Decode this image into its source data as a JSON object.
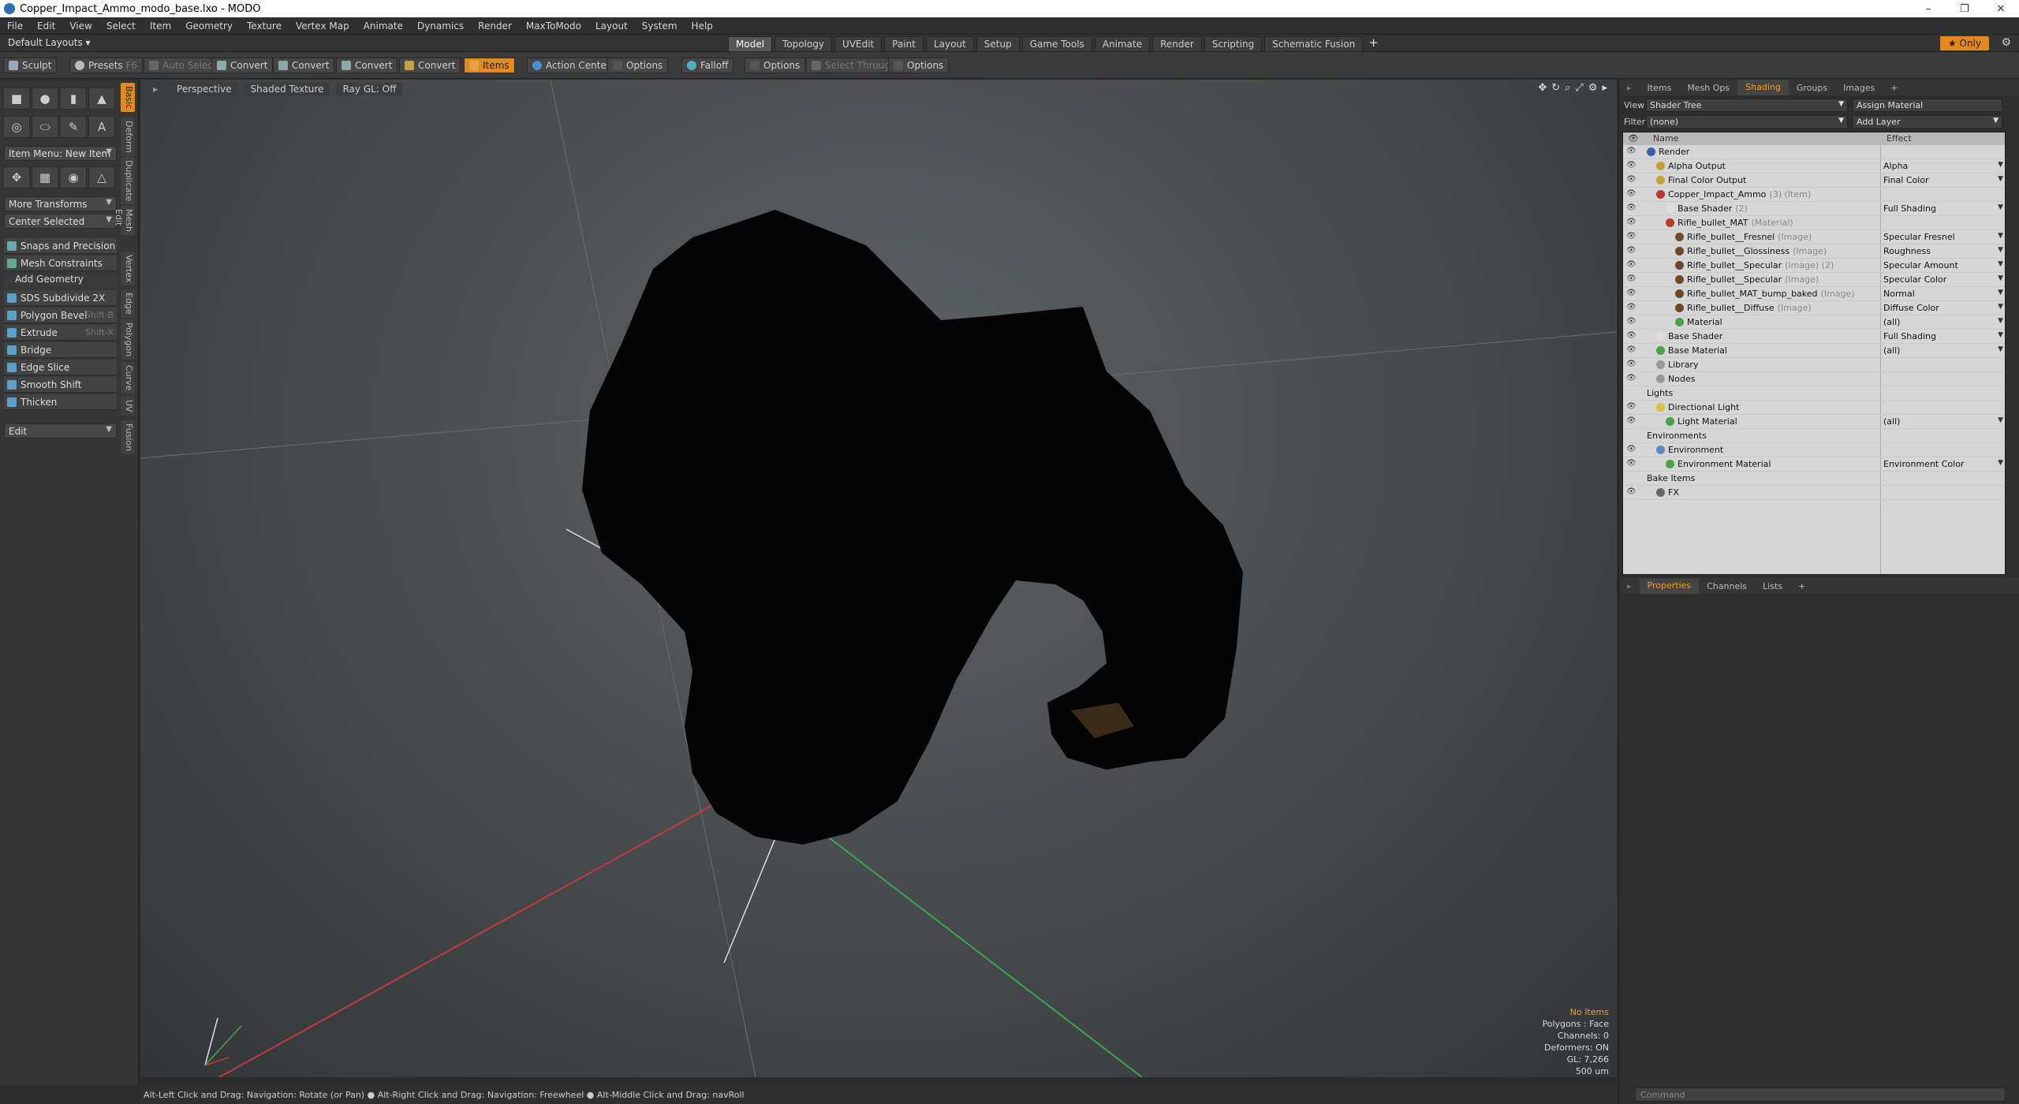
{
  "window": {
    "title": "Copper_Impact_Ammo_modo_base.lxo - MODO",
    "controls": [
      "–",
      "❐",
      "✕"
    ]
  },
  "menu": [
    "File",
    "Edit",
    "View",
    "Select",
    "Item",
    "Geometry",
    "Texture",
    "Vertex Map",
    "Animate",
    "Dynamics",
    "Render",
    "MaxToModo",
    "Layout",
    "System",
    "Help"
  ],
  "layoutbar": {
    "default_layouts": "Default Layouts ▾",
    "tabs": [
      "Model",
      "Topology",
      "UVEdit",
      "Paint",
      "Layout",
      "Setup",
      "Game Tools",
      "Animate",
      "Render",
      "Scripting",
      "Schematic Fusion"
    ],
    "active": "Model",
    "only": "★ Only",
    "plus": "+"
  },
  "toolbar": {
    "sculpt": "Sculpt",
    "presets": "Presets",
    "presets_key": "F6",
    "auto_select": "Auto Select",
    "convert1": "Convert",
    "convert2": "Convert",
    "convert3": "Convert",
    "convert4": "Convert",
    "items": "Items",
    "action_center": "Action Center",
    "options1": "Options",
    "falloff": "Falloff",
    "options2": "Options",
    "select_through": "Select Through",
    "options3": "Options"
  },
  "left": {
    "vtabs": [
      "Basic",
      "Deform",
      "Duplicate",
      "Mesh Edit",
      "Vertex",
      "Edge",
      "Polygon",
      "Curve",
      "UV",
      "Fusion"
    ],
    "item_menu": "Item Menu: New Item",
    "more_transforms": "More Transforms",
    "center_selected": "Center Selected",
    "snaps": "Snaps and Precision",
    "mesh_constraints": "Mesh Constraints",
    "add_geometry": "Add Geometry",
    "tools": [
      {
        "label": "SDS Subdivide 2X",
        "sc": ""
      },
      {
        "label": "Polygon Bevel",
        "sc": "Shift-B"
      },
      {
        "label": "Extrude",
        "sc": "Shift-X"
      },
      {
        "label": "Bridge",
        "sc": ""
      },
      {
        "label": "Edge Slice",
        "sc": ""
      },
      {
        "label": "Smooth Shift",
        "sc": ""
      },
      {
        "label": "Thicken",
        "sc": ""
      }
    ],
    "edit": "Edit"
  },
  "viewport": {
    "perspective": "Perspective",
    "shaded": "Shaded Texture",
    "raygl": "Ray GL: Off",
    "info": [
      "No Items",
      "Polygons : Face",
      "Channels: 0",
      "Deformers: ON",
      "GL: 7,266",
      "500 um"
    ]
  },
  "right": {
    "tabs": [
      "Items",
      "Mesh Ops",
      "Shading",
      "Groups",
      "Images",
      "+"
    ],
    "active": "Shading",
    "view_label": "View",
    "view_value": "Shader Tree",
    "assign": "Assign Material",
    "filter_label": "Filter",
    "filter_value": "(none)",
    "add_layer": "Add Layer",
    "col_name": "Name",
    "col_effect": "Effect",
    "tree": [
      {
        "i": 0,
        "name": "Render",
        "sub": "",
        "effect": "",
        "color": "#3e5fa8"
      },
      {
        "i": 1,
        "name": "Alpha Output",
        "sub": "",
        "effect": "Alpha",
        "color": "#c8a030"
      },
      {
        "i": 1,
        "name": "Final Color Output",
        "sub": "",
        "effect": "Final Color",
        "color": "#c8a030"
      },
      {
        "i": 1,
        "name": "Copper_Impact_Ammo",
        "sub": "(3) (Item)",
        "effect": "",
        "color": "#b83a2a"
      },
      {
        "i": 2,
        "name": "Base Shader",
        "sub": "(2)",
        "effect": "Full Shading",
        "color": "#dddddd"
      },
      {
        "i": 2,
        "name": "Rifle_bullet_MAT",
        "sub": "(Material)",
        "effect": "",
        "color": "#b83a2a"
      },
      {
        "i": 3,
        "name": "Rifle_bullet__Fresnel",
        "sub": "(Image)",
        "effect": "Specular Fresnel",
        "color": "#6a4a2a"
      },
      {
        "i": 3,
        "name": "Rifle_bullet__Glossiness",
        "sub": "(Image)",
        "effect": "Roughness",
        "color": "#6a4a2a"
      },
      {
        "i": 3,
        "name": "Rifle_bullet__Specular",
        "sub": "(Image) (2)",
        "effect": "Specular Amount",
        "color": "#6a4a2a"
      },
      {
        "i": 3,
        "name": "Rifle_bullet__Specular",
        "sub": "(Image)",
        "effect": "Specular Color",
        "color": "#6a4a2a"
      },
      {
        "i": 3,
        "name": "Rifle_bullet_MAT_bump_baked",
        "sub": "(Image)",
        "effect": "Normal",
        "color": "#6a4a2a"
      },
      {
        "i": 3,
        "name": "Rifle_bullet__Diffuse",
        "sub": "(Image)",
        "effect": "Diffuse Color",
        "color": "#6a4a2a"
      },
      {
        "i": 3,
        "name": "Material",
        "sub": "",
        "effect": "(all)",
        "color": "#4aa04a"
      },
      {
        "i": 1,
        "name": "Base Shader",
        "sub": "",
        "effect": "Full Shading",
        "color": "#dddddd"
      },
      {
        "i": 1,
        "name": "Base Material",
        "sub": "",
        "effect": "(all)",
        "color": "#4aa04a"
      },
      {
        "i": 1,
        "name": "Library",
        "sub": "",
        "effect": "",
        "color": "#999999"
      },
      {
        "i": 1,
        "name": "Nodes",
        "sub": "",
        "effect": "",
        "color": "#999999"
      },
      {
        "i": 0,
        "name": "Lights",
        "sub": "",
        "effect": "",
        "color": ""
      },
      {
        "i": 1,
        "name": "Directional Light",
        "sub": "",
        "effect": "",
        "color": "#d8c040"
      },
      {
        "i": 2,
        "name": "Light Material",
        "sub": "",
        "effect": "(all)",
        "color": "#4aa04a"
      },
      {
        "i": 0,
        "name": "Environments",
        "sub": "",
        "effect": "",
        "color": ""
      },
      {
        "i": 1,
        "name": "Environment",
        "sub": "",
        "effect": "",
        "color": "#5a8ac0"
      },
      {
        "i": 2,
        "name": "Environment Material",
        "sub": "",
        "effect": "Environment Color",
        "color": "#4aa04a"
      },
      {
        "i": 0,
        "name": "Bake Items",
        "sub": "",
        "effect": "",
        "color": ""
      },
      {
        "i": 1,
        "name": "FX",
        "sub": "",
        "effect": "",
        "color": "#666666"
      }
    ],
    "prop_tabs": [
      "Properties",
      "Channels",
      "Lists",
      "+"
    ],
    "prop_active": "Properties",
    "command": "Command"
  },
  "status": "Alt-Left Click and Drag: Navigation: Rotate (or Pan) ● Alt-Right Click and Drag: Navigation: Freewheel ● Alt-Middle Click and Drag: navRoll"
}
